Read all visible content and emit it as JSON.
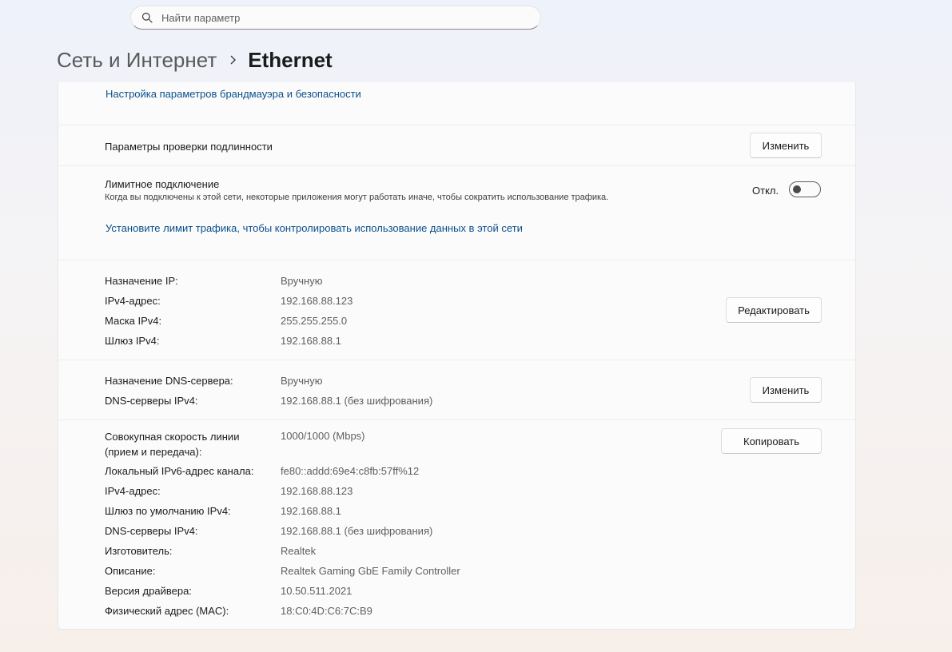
{
  "search": {
    "placeholder": "Найти параметр"
  },
  "breadcrumb": {
    "parent": "Сеть и Интернет",
    "current": "Ethernet"
  },
  "firewall_link": "Настройка параметров брандмауэра и безопасности",
  "auth": {
    "label": "Параметры проверки подлинности",
    "button": "Изменить"
  },
  "metered": {
    "title": "Лимитное подключение",
    "description": "Когда вы подключены к этой сети, некоторые приложения могут работать иначе, чтобы сократить использование трафика.",
    "state_label": "Откл.",
    "toggle_on": false,
    "limit_link": "Установите лимит трафика, чтобы контролировать использование данных в этой сети"
  },
  "ip": {
    "button": "Редактировать",
    "rows": [
      {
        "label": "Назначение IP:",
        "value": "Вручную"
      },
      {
        "label": "IPv4-адрес:",
        "value": "192.168.88.123"
      },
      {
        "label": "Маска IPv4:",
        "value": "255.255.255.0"
      },
      {
        "label": "Шлюз IPv4:",
        "value": "192.168.88.1"
      }
    ]
  },
  "dns": {
    "button": "Изменить",
    "rows": [
      {
        "label": "Назначение DNS-сервера:",
        "value": "Вручную"
      },
      {
        "label": "DNS-серверы IPv4:",
        "value": "192.168.88.1 (без шифрования)"
      }
    ]
  },
  "props": {
    "button": "Копировать",
    "speed_label_line1": "Совокупная скорость линии",
    "speed_label_line2": "(прием и передача):",
    "speed_value": "1000/1000 (Mbps)",
    "rows": [
      {
        "label": "Локальный IPv6-адрес канала:",
        "value": "fe80::addd:69e4:c8fb:57ff%12"
      },
      {
        "label": "IPv4-адрес:",
        "value": "192.168.88.123"
      },
      {
        "label": "Шлюз по умолчанию IPv4:",
        "value": "192.168.88.1"
      },
      {
        "label": "DNS-серверы IPv4:",
        "value": "192.168.88.1 (без шифрования)"
      },
      {
        "label": "Изготовитель:",
        "value": "Realtek"
      },
      {
        "label": "Описание:",
        "value": "Realtek Gaming GbE Family Controller"
      },
      {
        "label": "Версия драйвера:",
        "value": "10.50.511.2021"
      },
      {
        "label": "Физический адрес (MAC):",
        "value": "18:C0:4D:C6:7C:B9"
      }
    ]
  }
}
